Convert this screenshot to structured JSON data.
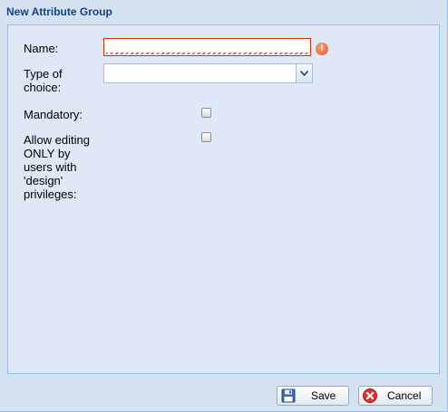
{
  "window": {
    "title": "New Attribute Group"
  },
  "form": {
    "name_label": "Name:",
    "name_value": "",
    "type_label_line1": "Type of",
    "type_label_line2": "choice:",
    "type_value": "",
    "mandatory_label": "Mandatory:",
    "mandatory_checked": false,
    "design_label_lines": [
      "Allow editing",
      "ONLY by",
      "users with",
      "'design'",
      "privileges:"
    ],
    "design_checked": false,
    "error_icon": "error-exclamation-icon"
  },
  "buttons": {
    "save_label": "Save",
    "cancel_label": "Cancel",
    "save_icon": "floppy-disk-icon",
    "cancel_icon": "red-x-icon"
  },
  "colors": {
    "title": "#15428b",
    "panel_bg": "#dfe8f6",
    "window_bg": "#d3e1f1",
    "invalid_border": "#cc3300"
  }
}
